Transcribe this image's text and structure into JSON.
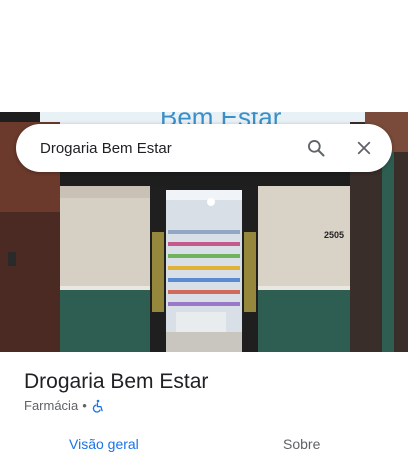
{
  "search": {
    "query": "Drogaria Bem Estar"
  },
  "photo": {
    "sign_text": "Bem Estar",
    "house_number": "2505"
  },
  "place": {
    "name": "Drogaria Bem Estar",
    "category": "Farmácia",
    "separator": "•"
  },
  "tabs": [
    {
      "label": "Visão geral",
      "active": true
    },
    {
      "label": "Sobre",
      "active": false
    }
  ],
  "colors": {
    "accent": "#1a73e8",
    "text_primary": "#202124",
    "text_secondary": "#5f6368",
    "wall_green": "#2e5e52",
    "sign_blue": "#3a8fc9"
  },
  "icons": {
    "search": "search-icon",
    "close": "close-icon",
    "accessibility": "wheelchair-icon"
  }
}
